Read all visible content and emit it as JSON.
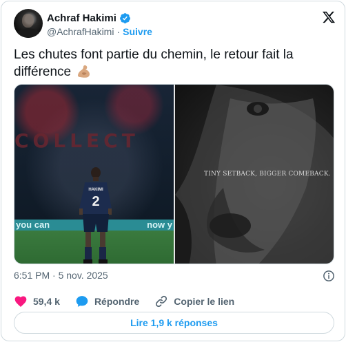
{
  "author": {
    "name": "Achraf Hakimi",
    "handle": "@AchrafHakimi",
    "separator": "·",
    "follow_label": "Suivre",
    "verified_color": "#1d9bf0"
  },
  "tweet": {
    "text": "Les chutes font partie du chemin, le retour fait la différence",
    "emoji": "flexed-biceps-icon"
  },
  "media": {
    "left_photo": {
      "banner_text": "COLLECT",
      "board_left": "you can",
      "board_right": "now y",
      "jersey_name": "HAKIMI",
      "jersey_number": "2"
    },
    "right_photo": {
      "caption": "TINY SETBACK, BIGGER COMEBACK."
    }
  },
  "timestamp": "6:51 PM · 5 nov. 2025",
  "actions": {
    "likes": "59,4 k",
    "reply_label": "Répondre",
    "copy_link_label": "Copier le lien"
  },
  "read_replies_label": "Lire 1,9 k réponses",
  "colors": {
    "accent": "#1d9bf0",
    "like": "#f91880",
    "muted": "#536471",
    "text": "#0f1419"
  }
}
